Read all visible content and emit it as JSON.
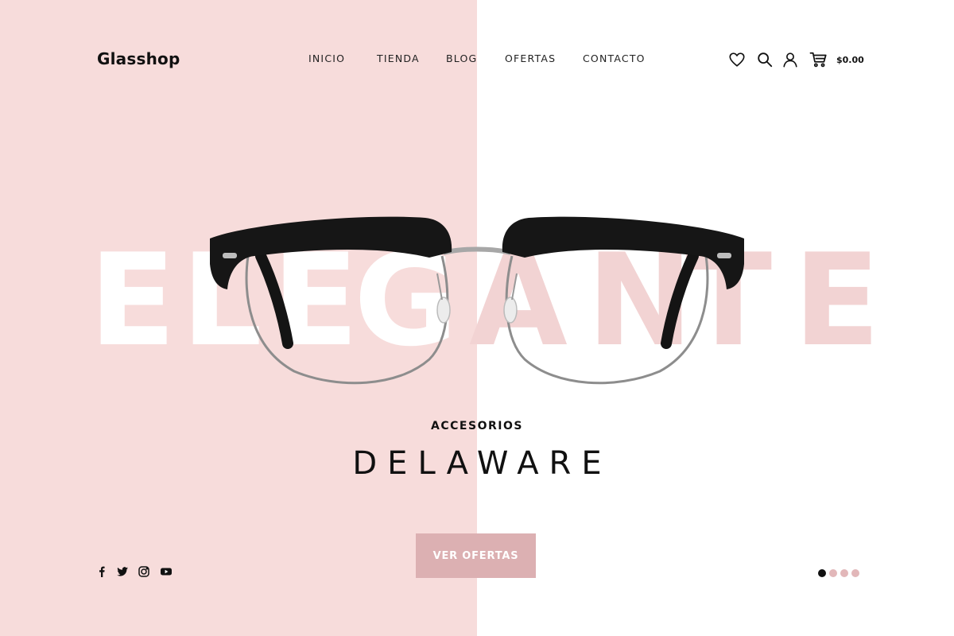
{
  "brand": {
    "logo": "Glasshop"
  },
  "nav": {
    "items": [
      {
        "label": "INICIO"
      },
      {
        "label": "TIENDA"
      },
      {
        "label": "BLOG"
      },
      {
        "label": "OFERTAS"
      },
      {
        "label": "CONTACTO"
      }
    ]
  },
  "header_icons": [
    "heart-icon",
    "search-icon",
    "user-icon",
    "cart-icon"
  ],
  "cart": {
    "total": "$0.00"
  },
  "hero": {
    "background_word": "ELEGANTE",
    "eyebrow": "ACCESORIOS",
    "title": "DELAWARE",
    "cta_label": "VER OFERTAS"
  },
  "social": [
    "facebook-icon",
    "twitter-icon",
    "instagram-icon",
    "youtube-icon"
  ],
  "slider": {
    "count": 4,
    "active_index": 0
  },
  "colors": {
    "pink_bg": "#f7dcdb",
    "accent_pink": "#dcb0b2",
    "dot_inactive": "#e2b7b9",
    "dot_active": "#111111",
    "text": "#111111"
  }
}
